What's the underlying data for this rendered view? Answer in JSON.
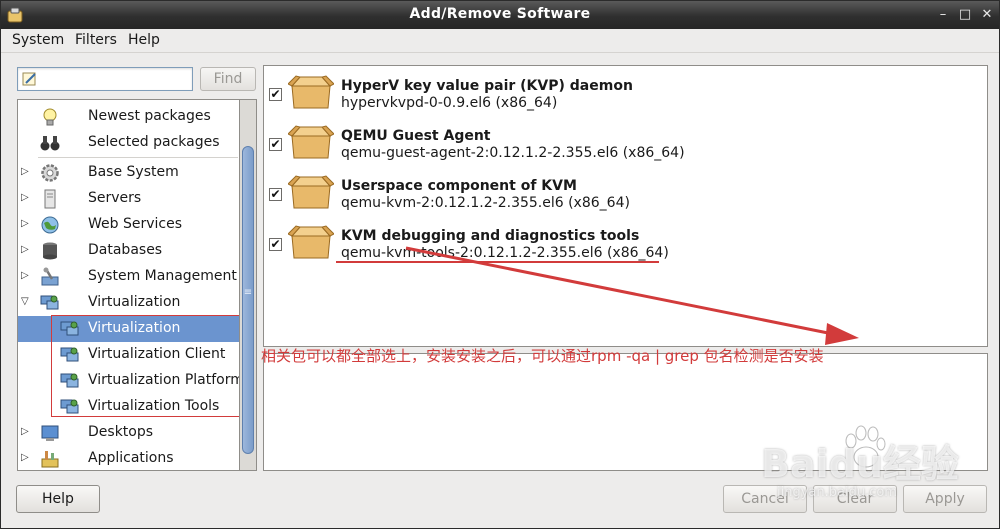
{
  "window": {
    "title": "Add/Remove Software"
  },
  "menu": [
    "System",
    "Filters",
    "Help"
  ],
  "search": {
    "value": "",
    "find_label": "Find"
  },
  "groups": [
    {
      "label": "Newest packages",
      "icon": "lightbulb-icon",
      "expander": "",
      "child": false
    },
    {
      "label": "Selected packages",
      "icon": "binoculars-icon",
      "expander": "",
      "child": false
    },
    {
      "label": "Base System",
      "icon": "gear-icon",
      "expander": "▷",
      "child": false
    },
    {
      "label": "Servers",
      "icon": "server-icon",
      "expander": "▷",
      "child": false
    },
    {
      "label": "Web Services",
      "icon": "globe-icon",
      "expander": "▷",
      "child": false
    },
    {
      "label": "Databases",
      "icon": "database-icon",
      "expander": "▷",
      "child": false
    },
    {
      "label": "System Management",
      "icon": "tools-icon",
      "expander": "▷",
      "child": false
    },
    {
      "label": "Virtualization",
      "icon": "virtualization-icon",
      "expander": "▽",
      "child": false
    },
    {
      "label": "Virtualization",
      "icon": "virtualization-icon",
      "expander": "",
      "child": true,
      "selected": true
    },
    {
      "label": "Virtualization Client",
      "icon": "virtualization-icon",
      "expander": "",
      "child": true
    },
    {
      "label": "Virtualization Platform",
      "icon": "virtualization-icon",
      "expander": "",
      "child": true
    },
    {
      "label": "Virtualization Tools",
      "icon": "virtualization-icon",
      "expander": "",
      "child": true
    },
    {
      "label": "Desktops",
      "icon": "desktop-icon",
      "expander": "▷",
      "child": false
    },
    {
      "label": "Applications",
      "icon": "applications-icon",
      "expander": "▷",
      "child": false
    }
  ],
  "packages": [
    {
      "name": "HyperV key value pair (KVP) daemon",
      "version": "hypervkvpd-0-0.9.el6 (x86_64)",
      "checked": true
    },
    {
      "name": "QEMU Guest Agent",
      "version": "qemu-guest-agent-2:0.12.1.2-2.355.el6 (x86_64)",
      "checked": true
    },
    {
      "name": "Userspace component of KVM",
      "version": "qemu-kvm-2:0.12.1.2-2.355.el6 (x86_64)",
      "checked": true
    },
    {
      "name": "KVM debugging and diagnostics tools",
      "version": "qemu-kvm-tools-2:0.12.1.2-2.355.el6 (x86_64)",
      "checked": true
    }
  ],
  "annotation": "相关包可以都全部选上，安装安装之后，可以通过rpm -qa | grep  包名检测是否安装",
  "buttons": {
    "help": "Help",
    "cancel": "Cancel",
    "clear": "Clear",
    "apply": "Apply"
  },
  "watermark": {
    "main": "Baidu经验",
    "sub": "jingyan.baidu.com"
  },
  "colors": {
    "selection": "#6b94cf",
    "annotation": "#d23b3b",
    "titlebar": "#2f2f2f"
  }
}
